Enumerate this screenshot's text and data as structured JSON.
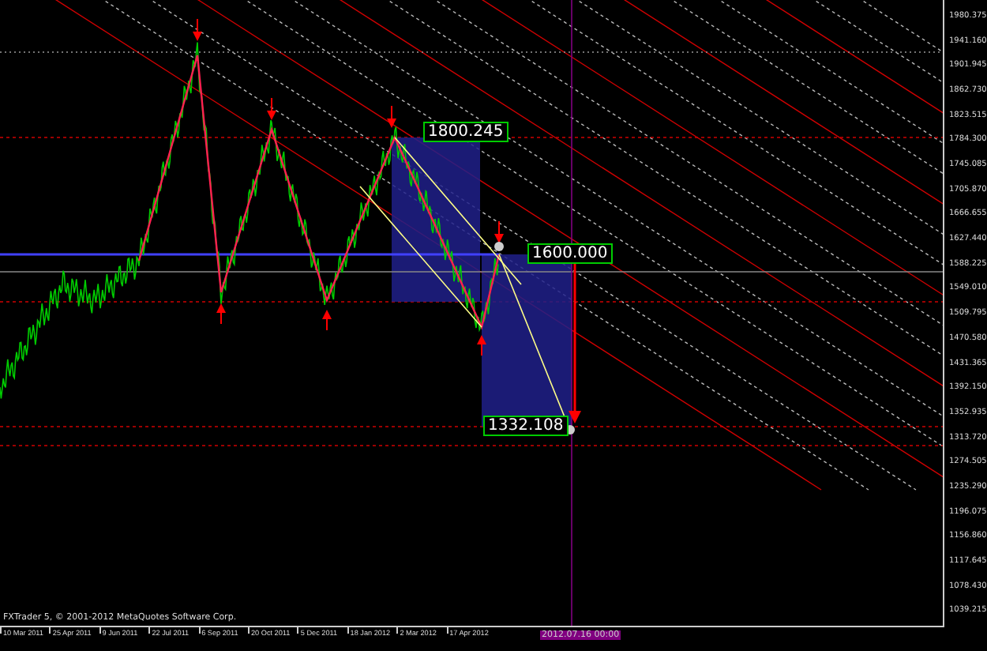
{
  "chart": {
    "copyright": "FXTrader 5, © 2001-2012 MetaQuotes Software Corp.",
    "price_labels": [
      "1800.245",
      "1600.000",
      "1332.108"
    ],
    "y_axis": [
      "1980.375",
      "1941.160",
      "1901.945",
      "1862.730",
      "1823.515",
      "1784.300",
      "1745.085",
      "1705.870",
      "1666.655",
      "1627.440",
      "1588.225",
      "1549.010",
      "1509.795",
      "1470.580",
      "1431.365",
      "1392.150",
      "1352.935",
      "1313.720",
      "1274.505",
      "1235.290",
      "1196.075",
      "1156.860",
      "1117.645",
      "1078.430",
      "1039.215"
    ],
    "x_axis": [
      "10 Mar 2011",
      "25 Apr 2011",
      "9 Jun 2011",
      "22 Jul 2011",
      "6 Sep 2011",
      "20 Oct 2011",
      "5 Dec 2011",
      "18 Jan 2012",
      "2 Mar 2012",
      "17 Apr 2012"
    ],
    "cursor_time": "2012.07.16 00:00"
  }
}
